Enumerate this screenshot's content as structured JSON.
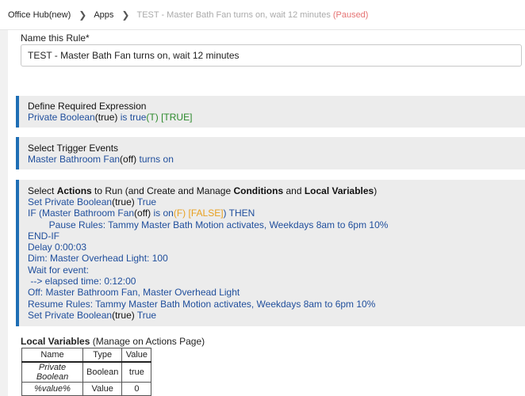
{
  "breadcrumb": {
    "items": [
      "Office Hub(new)",
      "Apps",
      "TEST - Master Bath Fan turns on, wait 12 minutes"
    ],
    "status": "(Paused)"
  },
  "rule_name": {
    "label": "Name this Rule*",
    "value": "TEST - Master Bath Fan turns on, wait 12 minutes"
  },
  "required_expression": {
    "title": "Define Required Expression",
    "line": {
      "a": "Private Boolean",
      "b": "(true)",
      "c": " is true",
      "d": "(T) [TRUE]"
    }
  },
  "trigger_events": {
    "title": "Select Trigger Events",
    "line": {
      "a": "Master Bathroom Fan",
      "b": "(off)",
      "c": " turns on"
    }
  },
  "actions": {
    "title": {
      "p1": "Select ",
      "p2": "Actions",
      "p3": " to Run (and Create and Manage ",
      "p4": "Conditions",
      "p5": " and ",
      "p6": "Local Variables",
      "p7": ")"
    },
    "l1": {
      "a": "Set Private Boolean",
      "b": "(true)",
      "c": " True"
    },
    "l2": {
      "a": "IF (Master Bathroom Fan",
      "b": "(off)",
      "c": " is on",
      "d": "(F) [FALSE]",
      "e": ") THEN"
    },
    "l3": "        Pause Rules: Tammy Master Bath Motion activates, Weekdays 8am to 6pm 10%",
    "l4": "END-IF",
    "l5": "Delay 0:00:03",
    "l6": "Dim: Master Overhead Light: 100",
    "l7": "Wait for event:",
    "l8": " --> elapsed time: 0:12:00",
    "l9": "Off: Master Bathroom Fan, Master Overhead Light",
    "l10": "Resume Rules: Tammy Master Bath Motion activates, Weekdays 8am to 6pm 10%",
    "l11": {
      "a": "Set Private Boolean",
      "b": "(true)",
      "c": " True"
    }
  },
  "local_variables": {
    "title": "Local Variables",
    "manage": " (Manage on Actions Page)",
    "headers": [
      "Name",
      "Type",
      "Value"
    ],
    "rows": [
      [
        "Private Boolean",
        "Boolean",
        "true"
      ],
      [
        "%value%",
        "Value",
        "0"
      ]
    ]
  },
  "colors": {
    "accent": "#1e6eb5",
    "link_text": "#1f4e9c",
    "true_green": "#2b8a2b",
    "false_orange": "#e8a020",
    "paused_red": "#e57373"
  }
}
